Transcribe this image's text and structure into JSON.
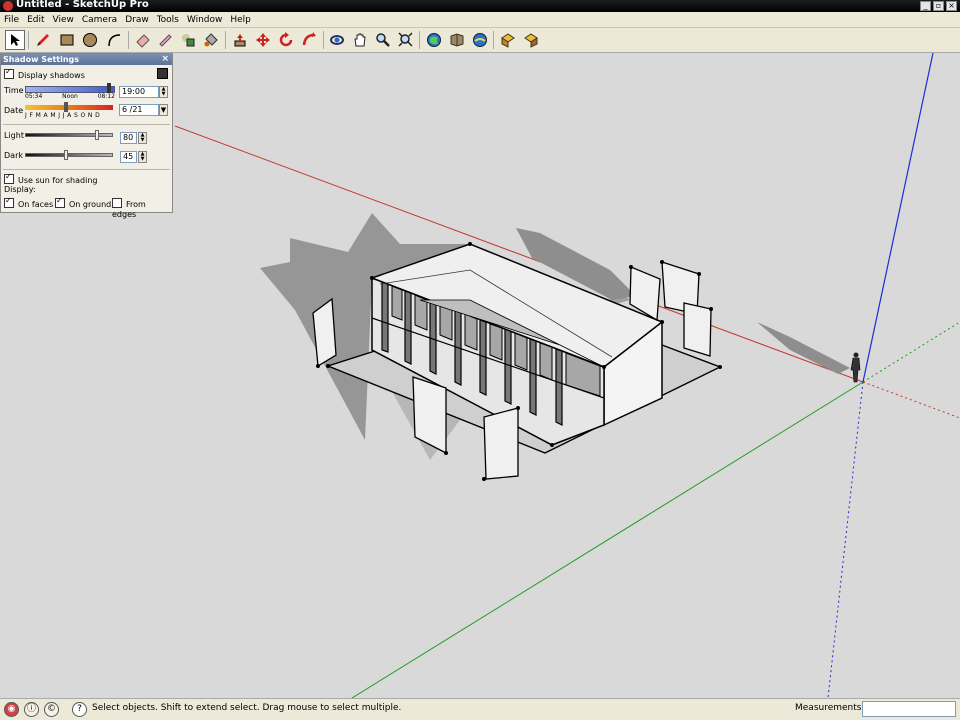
{
  "window": {
    "title": "Untitled - SketchUp Pro"
  },
  "menu": [
    "File",
    "Edit",
    "View",
    "Camera",
    "Draw",
    "Tools",
    "Window",
    "Help"
  ],
  "toolbar": {
    "tools": [
      "select-icon",
      "pencil-icon",
      "rectangle-icon",
      "circle-icon",
      "arc-icon",
      "eraser-icon",
      "paint-bucket-icon",
      "make-component-icon",
      "push-pull-icon",
      "move-icon",
      "rotate-icon",
      "follow-me-icon",
      "orbit-icon",
      "pan-icon",
      "zoom-icon",
      "zoom-extents-icon",
      "previous-view-icon",
      "next-view-icon",
      "get-models-icon",
      "share-model-icon",
      "components-icon"
    ]
  },
  "shadow_panel": {
    "title": "Shadow Settings",
    "display_shadows": {
      "label": "Display shadows",
      "checked": true
    },
    "time": {
      "label": "Time",
      "value": "19:00",
      "start": "05:34",
      "mid": "Noon",
      "end": "08:12"
    },
    "date": {
      "label": "Date",
      "value": "6 /21",
      "months": "J F M A M J  J A S O N D"
    },
    "light": {
      "label": "Light",
      "value": "80",
      "level": 0.8
    },
    "dark": {
      "label": "Dark",
      "value": "45",
      "level": 0.45
    },
    "use_sun": {
      "label": "Use sun for shading",
      "checked": true
    },
    "display_label": "Display:",
    "on_faces": {
      "label": "On faces",
      "checked": true
    },
    "on_ground": {
      "label": "On ground",
      "checked": true
    },
    "from_edges": {
      "label": "From edges",
      "checked": false
    }
  },
  "status": {
    "message": "Select objects. Shift to extend select. Drag mouse to select multiple.",
    "measurements_label": "Measurements",
    "measurements_value": ""
  },
  "colors": {
    "x_axis": "#c0392b",
    "y_axis": "#1e9e1e",
    "z_axis": "#1a2fd6",
    "ground": "#d9d9d9"
  }
}
